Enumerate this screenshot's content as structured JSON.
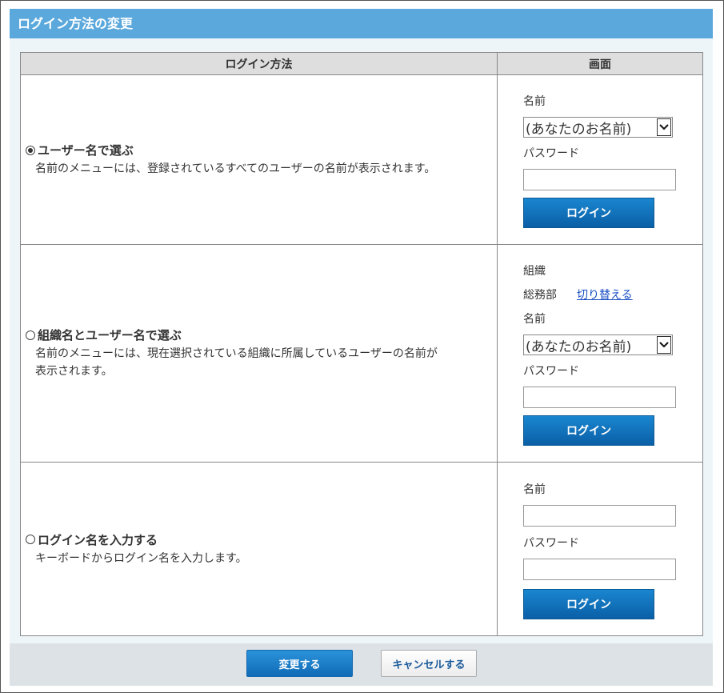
{
  "title": "ログイン方法の変更",
  "table": {
    "headers": [
      "ログイン方法",
      "画面"
    ]
  },
  "methods": [
    {
      "selected": true,
      "label": "ユーザー名で選ぶ",
      "description": "名前のメニューには、登録されているすべてのユーザーの名前が表示されます。",
      "screen": {
        "name_label": "名前",
        "name_select": "(あなたのお名前)",
        "password_label": "パスワード",
        "login_button": "ログイン"
      }
    },
    {
      "selected": false,
      "label": "組織名とユーザー名で選ぶ",
      "description_line1": "名前のメニューには、現在選択されている組織に所属しているユーザーの名前が",
      "description_line2": "表示されます。",
      "screen": {
        "org_label": "組織",
        "org_value": "総務部",
        "switch_link": "切り替える",
        "name_label": "名前",
        "name_select": "(あなたのお名前)",
        "password_label": "パスワード",
        "login_button": "ログイン"
      }
    },
    {
      "selected": false,
      "label": "ログイン名を入力する",
      "description": "キーボードからログイン名を入力します。",
      "screen": {
        "name_label": "名前",
        "password_label": "パスワード",
        "login_button": "ログイン"
      }
    }
  ],
  "footer": {
    "submit": "変更する",
    "cancel": "キャンセルする"
  },
  "icons": {
    "select_arrow": "chevron-down-icon",
    "radio_on": "radio-checked-icon",
    "radio_off": "radio-unchecked-icon"
  }
}
